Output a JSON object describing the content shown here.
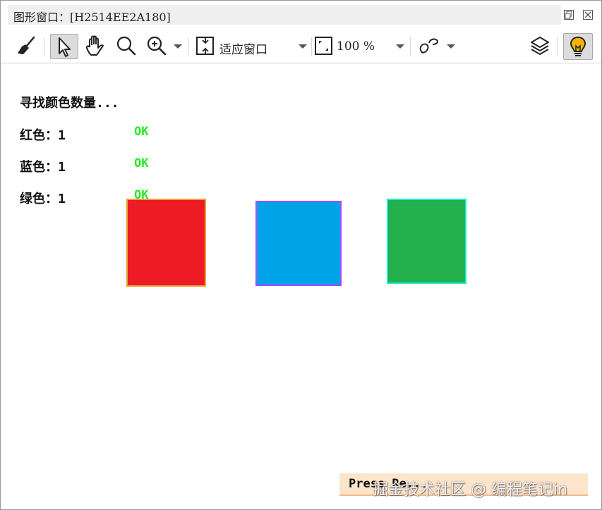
{
  "window": {
    "title": "图形窗口：[H2514EE2A180]",
    "controls": {
      "restore": "restore-icon",
      "close": "close-icon"
    }
  },
  "toolbar": {
    "tools": [
      "broom-icon",
      "pointer-icon",
      "hand-icon",
      "magnifier-icon",
      "zoom-in-icon",
      "fit-window-icon",
      "zoom-percent-icon",
      "shape-icon",
      "layers-icon",
      "lightbulb-icon"
    ],
    "fit_label": "适应窗口",
    "zoom_value": "100 %"
  },
  "console": {
    "heading": "寻找颜色数量...",
    "rows": [
      {
        "label": "红色：1",
        "status": "OK"
      },
      {
        "label": "蓝色：1",
        "status": "OK"
      },
      {
        "label": "绿色：1",
        "status": "OK"
      }
    ],
    "status_color": "#22ee22"
  },
  "squares": [
    {
      "color": "#ed1c24",
      "border": "#e8a23a"
    },
    {
      "color": "#00a2e8",
      "border": "#a64cff"
    },
    {
      "color": "#22b14c",
      "border": "#22e8d8"
    }
  ],
  "footer": {
    "text": "Press Re...",
    "watermark": "掘金技术社区 @ 编程笔记in"
  }
}
